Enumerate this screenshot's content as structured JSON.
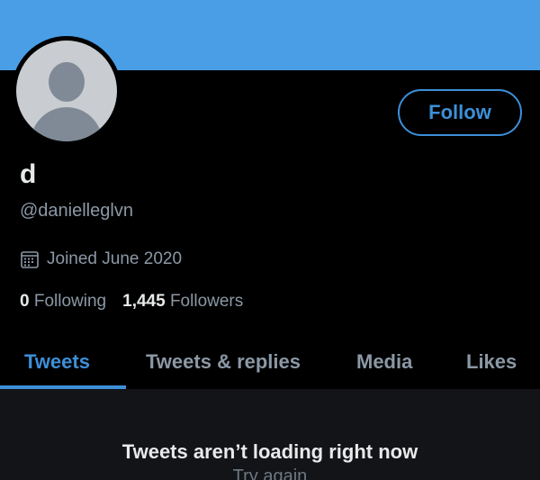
{
  "profile": {
    "display_name": "d",
    "handle": "@danielleglvn",
    "joined": "Joined June 2020",
    "following_count": "0",
    "following_label": "Following",
    "followers_count": "1,445",
    "followers_label": "Followers"
  },
  "actions": {
    "follow_label": "Follow"
  },
  "tabs": [
    {
      "label": "Tweets",
      "active": true
    },
    {
      "label": "Tweets & replies",
      "active": false
    },
    {
      "label": "Media",
      "active": false
    },
    {
      "label": "Likes",
      "active": false
    }
  ],
  "feed": {
    "error_message": "Tweets aren’t loading right now",
    "retry_label": "Try again"
  },
  "icons": {
    "calendar": "calendar-icon",
    "avatar": "default-avatar-icon"
  },
  "colors": {
    "banner": "#4a9ee6",
    "accent": "#3d8fd8",
    "background": "#000000",
    "secondary_text": "#8b98a5"
  }
}
